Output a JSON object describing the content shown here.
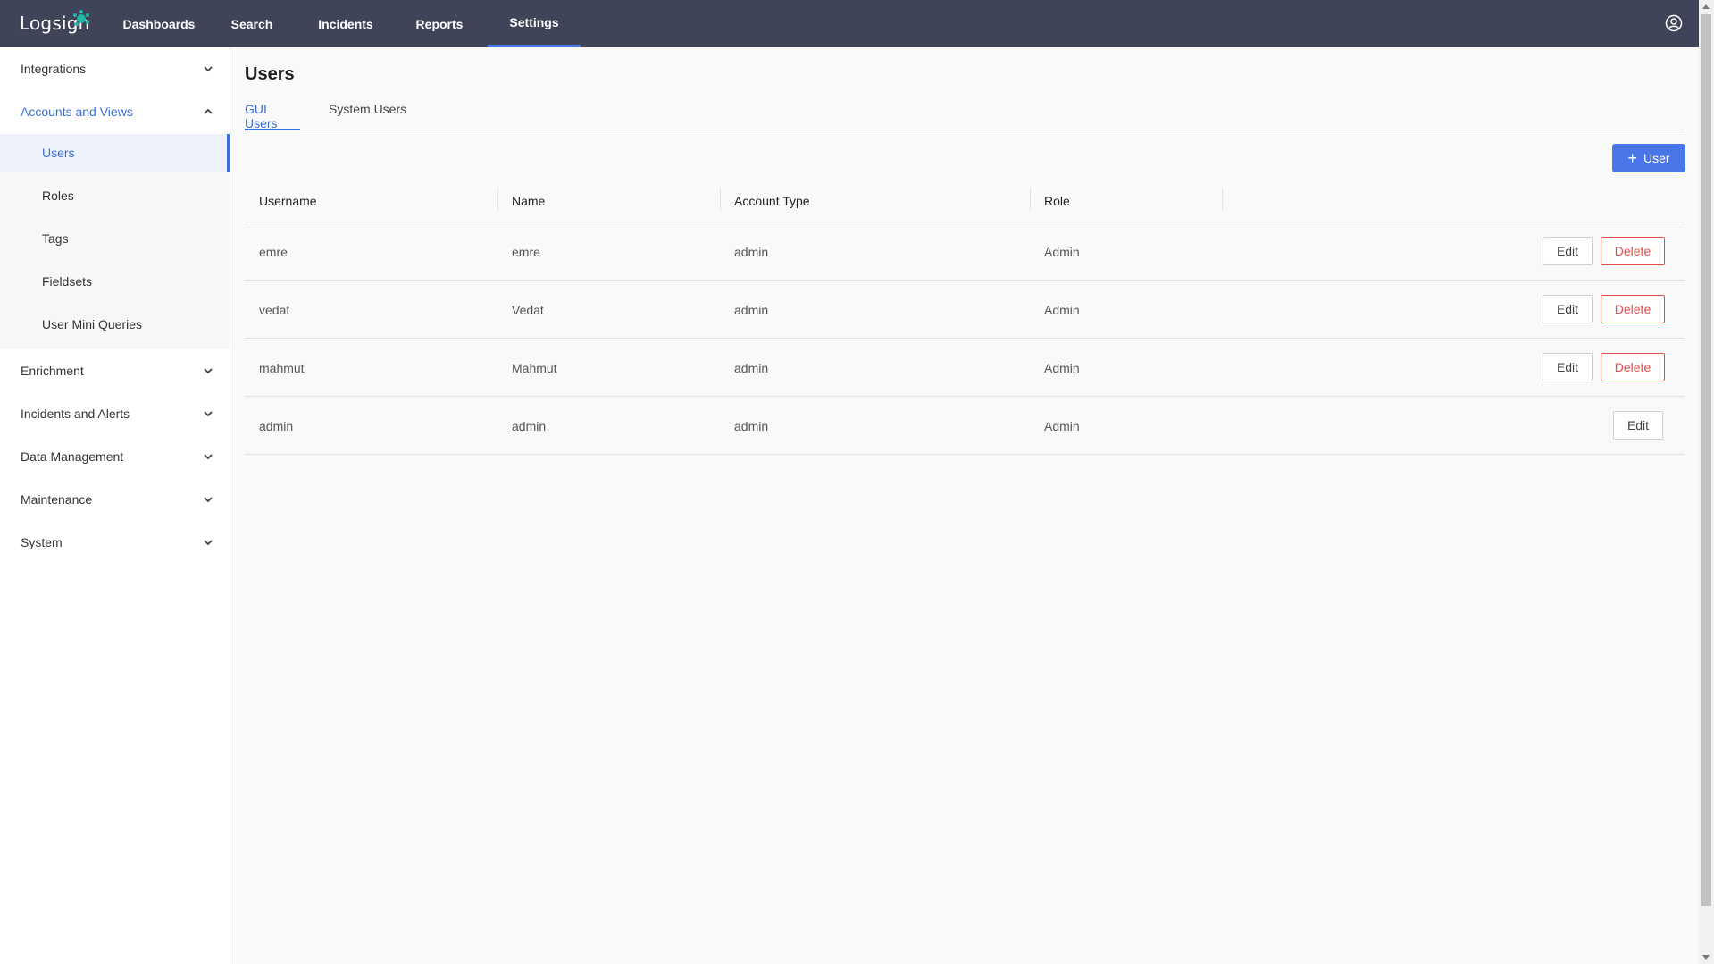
{
  "app": {
    "logo_text": "Logsign",
    "nav": [
      {
        "label": "Dashboards"
      },
      {
        "label": "Search"
      },
      {
        "label": "Incidents"
      },
      {
        "label": "Reports"
      },
      {
        "label": "Settings"
      }
    ],
    "active_nav": "Settings",
    "accent_color": "#3b6fd8",
    "topbar_color": "#3f4458"
  },
  "sidebar": {
    "groups": [
      {
        "label": "Integrations"
      },
      {
        "label": "Accounts and Views"
      },
      {
        "label": "Enrichment"
      },
      {
        "label": "Incidents and Alerts"
      },
      {
        "label": "Data Management"
      },
      {
        "label": "Maintenance"
      },
      {
        "label": "System"
      }
    ],
    "sub_items": [
      {
        "label": "Users"
      },
      {
        "label": "Roles"
      },
      {
        "label": "Tags"
      },
      {
        "label": "Fieldsets"
      },
      {
        "label": "User Mini Queries"
      }
    ],
    "active_item": "Users"
  },
  "main": {
    "title": "Users",
    "tabs": [
      {
        "label": "GUI Users"
      },
      {
        "label": "System Users"
      }
    ],
    "active_tab": "GUI Users",
    "add_button_label": "User",
    "table": {
      "columns": [
        "Username",
        "Name",
        "Account Type",
        "Role"
      ],
      "rows": [
        {
          "username": "emre",
          "name": "emre",
          "account_type": "admin",
          "role": "Admin",
          "edit": "Edit",
          "delete": "Delete"
        },
        {
          "username": "vedat",
          "name": "Vedat",
          "account_type": "admin",
          "role": "Admin",
          "edit": "Edit",
          "delete": "Delete"
        },
        {
          "username": "mahmut",
          "name": "Mahmut",
          "account_type": "admin",
          "role": "Admin",
          "edit": "Edit",
          "delete": "Delete"
        },
        {
          "username": "admin",
          "name": "admin",
          "account_type": "admin",
          "role": "Admin",
          "edit": "Edit"
        }
      ]
    }
  }
}
